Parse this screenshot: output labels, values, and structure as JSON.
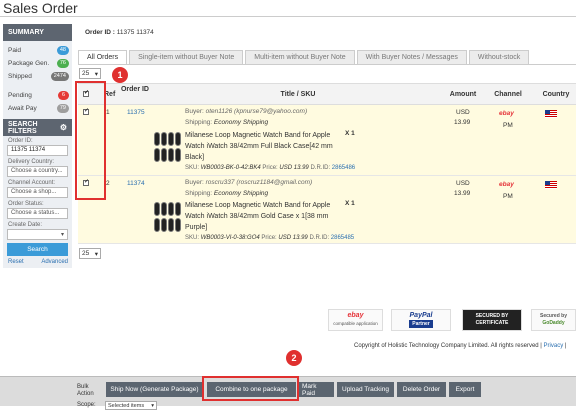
{
  "page": {
    "title": "Sales Order"
  },
  "order_filter": {
    "label": "Order ID :",
    "value": "11375 11374"
  },
  "sidebar": {
    "summary_title": "SUMMARY",
    "summary": [
      {
        "label": "Paid",
        "count": "48",
        "color": "#3b9bd8"
      },
      {
        "label": "Package Gen.",
        "count": "76",
        "color": "#4caf50"
      },
      {
        "label": "Shipped",
        "count": "2474",
        "color": "#777777"
      }
    ],
    "status": [
      {
        "label": "Pending",
        "count": "6",
        "color": "#e53935"
      },
      {
        "label": "Await Pay",
        "count": "79",
        "color": "#9e9e9e"
      }
    ],
    "filters_title": "SEARCH FILTERS",
    "order_id_label": "Order ID:",
    "order_id_value": "11375 11374",
    "delivery_country_label": "Delivery Country:",
    "delivery_country_placeholder": "Choose a country...",
    "channel_account_label": "Channel Account:",
    "channel_account_placeholder": "Choose a shop...",
    "order_status_label": "Order Status:",
    "order_status_placeholder": "Choose a status...",
    "create_date_label": "Create Date:",
    "search_label": "Search",
    "reset_label": "Reset",
    "advanced_label": "Advanced"
  },
  "tabs": [
    {
      "label": "All Orders",
      "active": true
    },
    {
      "label": "Single-item without Buyer Note",
      "active": false
    },
    {
      "label": "Multi-item without Buyer Note",
      "active": false
    },
    {
      "label": "With Buyer Notes / Messages",
      "active": false
    },
    {
      "label": "Without-stock",
      "active": false
    }
  ],
  "page_size": "25",
  "columns": {
    "ref": "Ref",
    "order_id": "Order ID",
    "title_sku": "Title / SKU",
    "amount": "Amount",
    "channel": "Channel",
    "country": "Country"
  },
  "orders": [
    {
      "ref": "1",
      "order_id": "11375",
      "buyer_label": "Buyer:",
      "buyer": "oten1126 (kpnurse79@yahoo.com)",
      "shipping_label": "Shipping:",
      "shipping": "Economy Shipping",
      "item_title": "Milanese Loop Magnetic Watch Band for Apple Watch iWatch 38/42mm Full Black Case[42 mm Black]",
      "qty": "X 1",
      "sku_label": "SKU:",
      "sku": "WB0003-BK-0-42:BK4",
      "price_label": "Price:",
      "price": "USD 13.99",
      "drid_label": "D.R.ID:",
      "drid": "2865486",
      "currency": "USD",
      "amount": "13.99",
      "channel": "ebay",
      "channel_sub": "PM"
    },
    {
      "ref": "2",
      "order_id": "11374",
      "buyer_label": "Buyer:",
      "buyer": "roscru337 (roscruz1184@gmail.com)",
      "shipping_label": "Shipping:",
      "shipping": "Economy Shipping",
      "item_title": "Milanese Loop Magnetic Watch Band for Apple Watch iWatch 38/42mm Gold Case x 1[38 mm Purple]",
      "qty": "X 1",
      "sku_label": "SKU:",
      "sku": "WB0003-VI-0-38:GO4",
      "price_label": "Price:",
      "price": "USD 13.99",
      "drid_label": "D.R.ID:",
      "drid": "2865485",
      "currency": "USD",
      "amount": "13.99",
      "channel": "ebay",
      "channel_sub": "PM"
    }
  ],
  "badges": [
    {
      "top": "ebay",
      "sub": "compatible application"
    },
    {
      "top": "PayPal",
      "sub": "Partner"
    },
    {
      "top": "SECURED BY",
      "sub": "CERTIFICATE"
    },
    {
      "top": "Secured by",
      "sub": "GoDaddy"
    }
  ],
  "copyright": "Copyright of Holistic Technology Company Limited. All rights reserved |",
  "privacy": "Privacy",
  "bulk": {
    "label": "Bulk Action",
    "scope_label": "Scope:",
    "scope_value": "Selected items",
    "buttons": [
      "Ship Now (Generate Package)",
      "Combine to one package",
      "Mark Paid",
      "Upload Tracking",
      "Delete Order",
      "Export"
    ]
  },
  "callouts": [
    "1",
    "2"
  ],
  "colors": {
    "highlight": "#e0302f",
    "accent": "#3b9bd8",
    "row_bg": "#fffbe0"
  }
}
